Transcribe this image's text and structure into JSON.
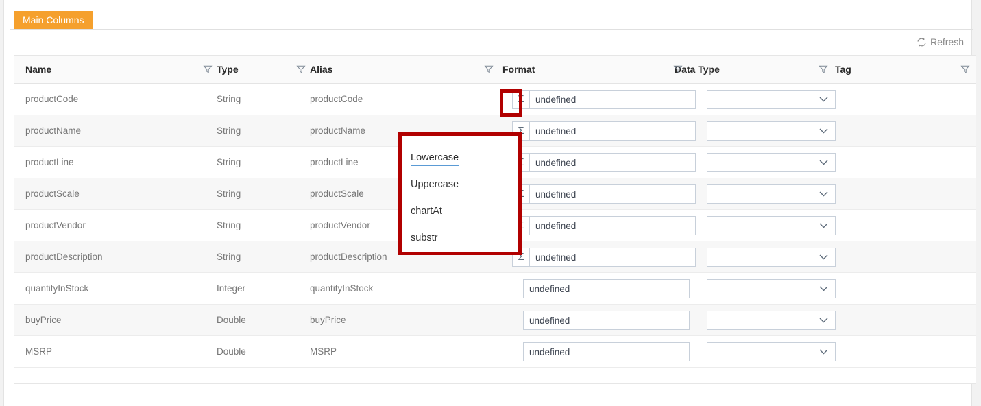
{
  "tabs": [
    {
      "label": "Main Columns",
      "active": true
    }
  ],
  "toolbar": {
    "refresh_label": "Refresh",
    "refresh_icon": "refresh-icon"
  },
  "table": {
    "columns": [
      {
        "key": "name",
        "label": "Name",
        "filter_icon": "filter-icon"
      },
      {
        "key": "type",
        "label": "Type",
        "filter_icon": "filter-icon"
      },
      {
        "key": "alias",
        "label": "Alias",
        "filter_icon": "filter-icon"
      },
      {
        "key": "format",
        "label": "Format",
        "filter_icon": "filter-icon"
      },
      {
        "key": "data_type",
        "label": "Data Type",
        "filter_icon": "filter-icon"
      },
      {
        "key": "tag",
        "label": "Tag",
        "filter_icon": "filter-icon"
      }
    ],
    "sigma_symbol": "Σ",
    "rows": [
      {
        "name": "productCode",
        "type": "String",
        "alias": "productCode",
        "format": "undefined",
        "data_type": "",
        "tag": ""
      },
      {
        "name": "productName",
        "type": "String",
        "alias": "productName",
        "format": "undefined",
        "data_type": "",
        "tag": ""
      },
      {
        "name": "productLine",
        "type": "String",
        "alias": "productLine",
        "format": "undefined",
        "data_type": "",
        "tag": ""
      },
      {
        "name": "productScale",
        "type": "String",
        "alias": "productScale",
        "format": "undefined",
        "data_type": "",
        "tag": ""
      },
      {
        "name": "productVendor",
        "type": "String",
        "alias": "productVendor",
        "format": "undefined",
        "data_type": "",
        "tag": ""
      },
      {
        "name": "productDescription",
        "type": "String",
        "alias": "productDescription",
        "format": "undefined",
        "data_type": "",
        "tag": ""
      },
      {
        "name": "quantityInStock",
        "type": "Integer",
        "alias": "quantityInStock",
        "format": "undefined",
        "data_type": "",
        "tag": ""
      },
      {
        "name": "buyPrice",
        "type": "Double",
        "alias": "buyPrice",
        "format": "undefined",
        "data_type": "",
        "tag": ""
      },
      {
        "name": "MSRP",
        "type": "Double",
        "alias": "MSRP",
        "format": "undefined",
        "data_type": "",
        "tag": ""
      }
    ]
  },
  "function_dropdown": {
    "open": true,
    "items": [
      {
        "label": "Lowercase",
        "selected": true
      },
      {
        "label": "Uppercase",
        "selected": false
      },
      {
        "label": "chartAt",
        "selected": false
      },
      {
        "label": "substr",
        "selected": false
      }
    ]
  },
  "colors": {
    "tab_active_bg": "#f5a02d",
    "tab_active_text": "#ffffff",
    "highlight_border": "#b10000",
    "selected_underline": "#5b9bd5",
    "header_text": "#2b2b2b",
    "cell_text": "#777777",
    "input_border": "#c8d0da"
  }
}
